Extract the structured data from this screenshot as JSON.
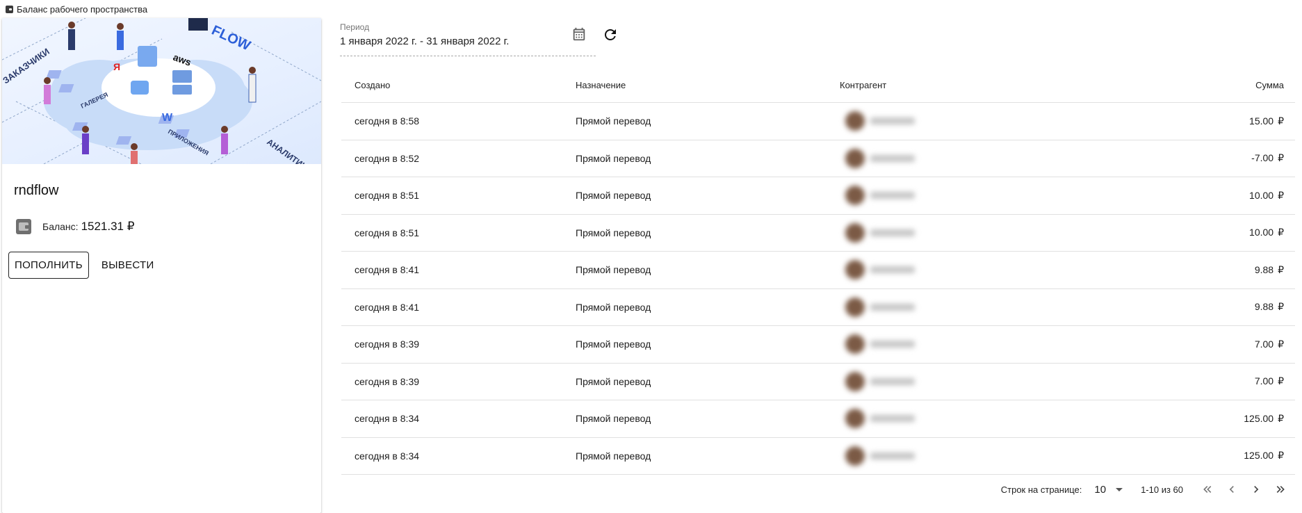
{
  "window": {
    "title": "Баланс рабочего пространства"
  },
  "card": {
    "name": "rndflow",
    "balance_label": "Баланс:",
    "balance_value": "1521.31",
    "currency": "₽",
    "deposit_label": "ПОПОЛНИТЬ",
    "withdraw_label": "ВЫВЕСТИ"
  },
  "period": {
    "label": "Период",
    "value": "1 января 2022 г. - 31 января 2022 г."
  },
  "table": {
    "headers": {
      "created": "Создано",
      "purpose": "Назначение",
      "party": "Контрагент",
      "sum": "Сумма"
    },
    "rows": [
      {
        "created": "сегодня в 8:58",
        "purpose": "Прямой перевод",
        "sum": "15.00"
      },
      {
        "created": "сегодня в 8:52",
        "purpose": "Прямой перевод",
        "sum": "-7.00"
      },
      {
        "created": "сегодня в 8:51",
        "purpose": "Прямой перевод",
        "sum": "10.00"
      },
      {
        "created": "сегодня в 8:51",
        "purpose": "Прямой перевод",
        "sum": "10.00"
      },
      {
        "created": "сегодня в 8:41",
        "purpose": "Прямой перевод",
        "sum": "9.88"
      },
      {
        "created": "сегодня в 8:41",
        "purpose": "Прямой перевод",
        "sum": "9.88"
      },
      {
        "created": "сегодня в 8:39",
        "purpose": "Прямой перевод",
        "sum": "7.00"
      },
      {
        "created": "сегодня в 8:39",
        "purpose": "Прямой перевод",
        "sum": "7.00"
      },
      {
        "created": "сегодня в 8:34",
        "purpose": "Прямой перевод",
        "sum": "125.00"
      },
      {
        "created": "сегодня в 8:34",
        "purpose": "Прямой перевод",
        "sum": "125.00"
      }
    ],
    "currency": "₽"
  },
  "pager": {
    "rows_label": "Строк на странице:",
    "rows_value": "10",
    "range": "1-10 из 60"
  },
  "icons": {
    "wallet": "wallet-icon",
    "calendar": "calendar-icon",
    "refresh": "refresh-icon",
    "first": "first-page-icon",
    "prev": "prev-page-icon",
    "next": "next-page-icon",
    "last": "last-page-icon"
  }
}
